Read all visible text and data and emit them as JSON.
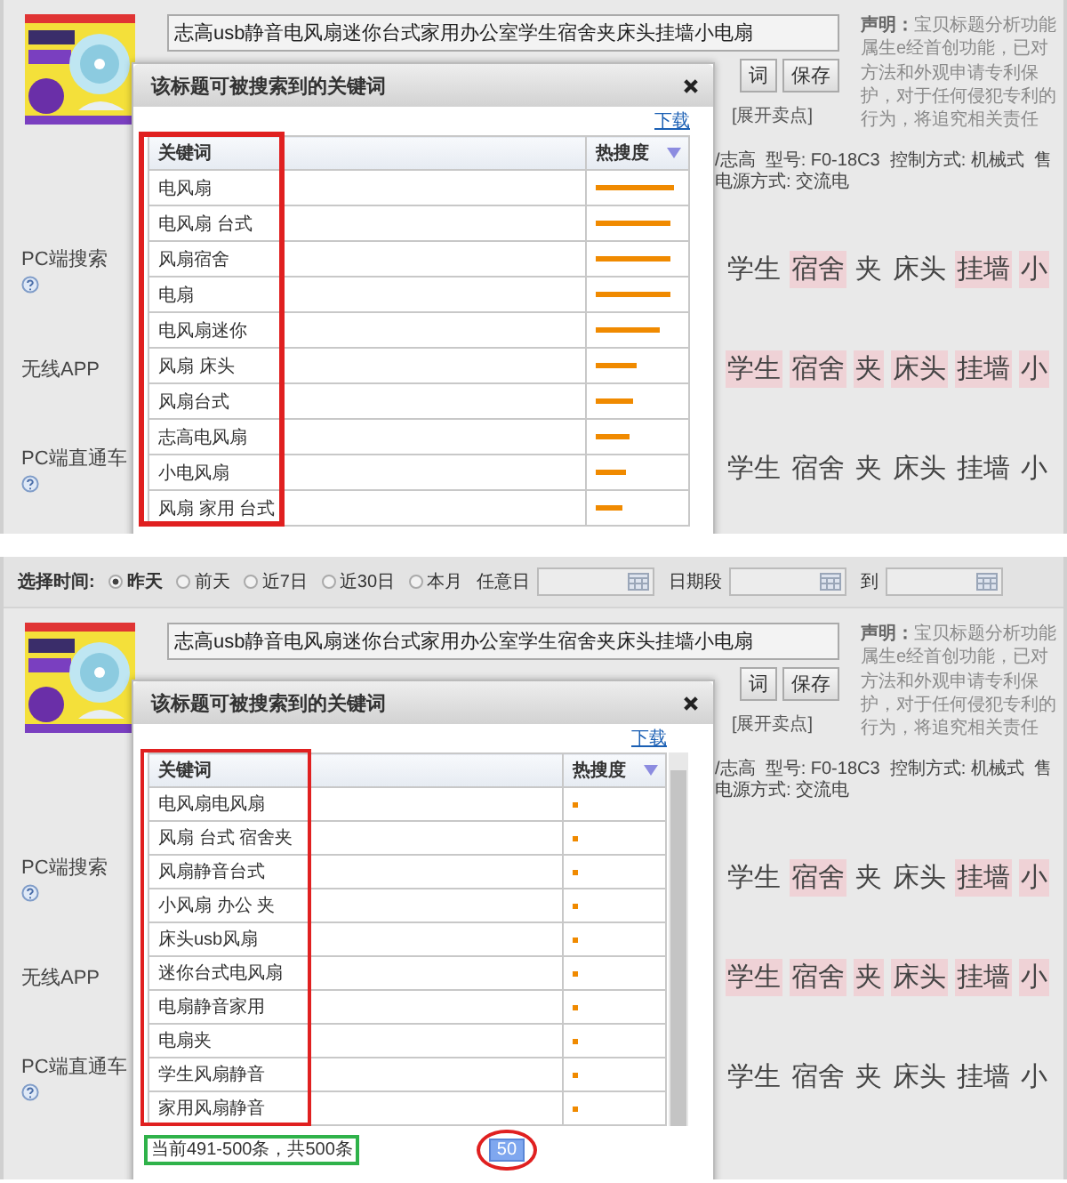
{
  "panels": [
    {
      "product_title": "志高usb静音电风扇迷你台式家用办公室学生宿舍夹床头挂墙小电扇",
      "buttons": [
        "词",
        "保存"
      ],
      "expand_link": "[展开卖点]",
      "disclaimer": "**声明：**宝贝标题分析功能属生e经首创功能，已对方法和外观申请专利保护，对于任何侵犯专利的行为，将追究相关责任",
      "attributes": [
        "/志高  型号: F0-18C3  控制方式: 机械式  售",
        "电源方式: 交流电"
      ],
      "keyword_rows": [
        {
          "label": "PC端搜索",
          "help": true,
          "tokens": [
            {
              "text": "学生",
              "highlighted": false
            },
            {
              "text": "宿舍",
              "highlighted": true
            },
            {
              "text": "夹",
              "highlighted": false
            },
            {
              "text": "床头",
              "highlighted": false
            },
            {
              "text": "挂墙",
              "highlighted": true
            },
            {
              "text": "小",
              "highlighted": true
            }
          ]
        },
        {
          "label": "无线APP",
          "help": false,
          "tokens": [
            {
              "text": "学生",
              "highlighted": true
            },
            {
              "text": "宿舍",
              "highlighted": true
            },
            {
              "text": "夹",
              "highlighted": true
            },
            {
              "text": "床头",
              "highlighted": true
            },
            {
              "text": "挂墙",
              "highlighted": true
            },
            {
              "text": "小",
              "highlighted": true
            }
          ]
        },
        {
          "label": "PC端直通车",
          "help": true,
          "tokens": [
            {
              "text": "学生",
              "highlighted": false
            },
            {
              "text": "宿舍",
              "highlighted": false
            },
            {
              "text": "夹",
              "highlighted": false
            },
            {
              "text": "床头",
              "highlighted": false
            },
            {
              "text": "挂墙",
              "highlighted": false
            },
            {
              "text": "小",
              "highlighted": false
            }
          ]
        }
      ],
      "dialog": {
        "title": "该标题可被搜索到的关键词",
        "download": "下载",
        "columns": [
          "关键词",
          "热搜度"
        ],
        "scrollbar": false,
        "rows": [
          {
            "keyword": "电风扇",
            "level": 0.8
          },
          {
            "keyword": "电风扇 台式",
            "level": 0.76
          },
          {
            "keyword": "风扇宿舍",
            "level": 0.76
          },
          {
            "keyword": "电扇",
            "level": 0.76
          },
          {
            "keyword": "电风扇迷你",
            "level": 0.66
          },
          {
            "keyword": "风扇 床头",
            "level": 0.42
          },
          {
            "keyword": "风扇台式",
            "level": 0.38
          },
          {
            "keyword": "志高电风扇",
            "level": 0.34
          },
          {
            "keyword": "小电风扇",
            "level": 0.3
          },
          {
            "keyword": "风扇 家用 台式",
            "level": 0.28
          }
        ]
      }
    },
    {
      "time_filter": {
        "label": "选择时间:",
        "options": [
          {
            "label": "昨天",
            "selected": true
          },
          {
            "label": "前天",
            "selected": false
          },
          {
            "label": "近7日",
            "selected": false
          },
          {
            "label": "近30日",
            "selected": false
          },
          {
            "label": "本月",
            "selected": false
          }
        ],
        "date_label": "任意日",
        "range_label": "日期段",
        "to_label": "到"
      },
      "product_title": "志高usb静音电风扇迷你台式家用办公室学生宿舍夹床头挂墙小电扇",
      "buttons": [
        "词",
        "保存"
      ],
      "expand_link": "[展开卖点]",
      "disclaimer": "**声明：**宝贝标题分析功能属生e经首创功能，已对方法和外观申请专利保护，对于任何侵犯专利的行为，将追究相关责任",
      "attributes": [
        "/志高  型号: F0-18C3  控制方式: 机械式  售",
        "电源方式: 交流电"
      ],
      "keyword_rows": [
        {
          "label": "PC端搜索",
          "help": true,
          "tokens": [
            {
              "text": "学生",
              "highlighted": false
            },
            {
              "text": "宿舍",
              "highlighted": true
            },
            {
              "text": "夹",
              "highlighted": false
            },
            {
              "text": "床头",
              "highlighted": false
            },
            {
              "text": "挂墙",
              "highlighted": true
            },
            {
              "text": "小",
              "highlighted": true
            }
          ]
        },
        {
          "label": "无线APP",
          "help": false,
          "tokens": [
            {
              "text": "学生",
              "highlighted": true
            },
            {
              "text": "宿舍",
              "highlighted": true
            },
            {
              "text": "夹",
              "highlighted": true
            },
            {
              "text": "床头",
              "highlighted": true
            },
            {
              "text": "挂墙",
              "highlighted": true
            },
            {
              "text": "小",
              "highlighted": true
            }
          ]
        },
        {
          "label": "PC端直通车",
          "help": true,
          "tokens": [
            {
              "text": "学生",
              "highlighted": false
            },
            {
              "text": "宿舍",
              "highlighted": false
            },
            {
              "text": "夹",
              "highlighted": false
            },
            {
              "text": "床头",
              "highlighted": false
            },
            {
              "text": "挂墙",
              "highlighted": false
            },
            {
              "text": "小",
              "highlighted": false
            }
          ]
        }
      ],
      "dialog": {
        "title": "该标题可被搜索到的关键词",
        "download": "下载",
        "columns": [
          "关键词",
          "热搜度"
        ],
        "scrollbar": true,
        "rows": [
          {
            "keyword": "电风扇电风扇",
            "level": 0.05
          },
          {
            "keyword": "风扇 台式 宿舍夹",
            "level": 0.05
          },
          {
            "keyword": "风扇静音台式",
            "level": 0.05
          },
          {
            "keyword": "小风扇 办公 夹",
            "level": 0.05
          },
          {
            "keyword": "床头usb风扇",
            "level": 0.05
          },
          {
            "keyword": "迷你台式电风扇",
            "level": 0.05
          },
          {
            "keyword": "电扇静音家用",
            "level": 0.05
          },
          {
            "keyword": "电扇夹",
            "level": 0.05
          },
          {
            "keyword": "学生风扇静音",
            "level": 0.05
          },
          {
            "keyword": "家用风扇静音",
            "level": 0.05
          }
        ],
        "footer": "当前491-500条，共500条",
        "pages": [
          {
            "label": "50",
            "selected": true
          }
        ]
      }
    }
  ]
}
